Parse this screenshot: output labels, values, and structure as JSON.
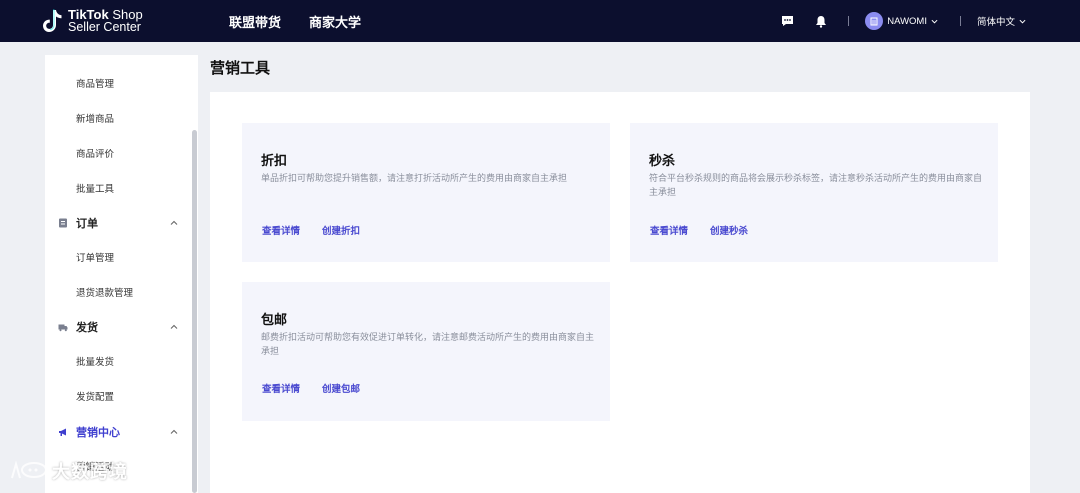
{
  "header": {
    "logo_line1_bold": "TikTok",
    "logo_line1_light": " Shop",
    "logo_line2": "Seller Center",
    "nav": [
      "联盟带货",
      "商家大学"
    ],
    "user_name": "NAWOMI",
    "language": "简体中文"
  },
  "sidebar": {
    "items": [
      {
        "type": "sub",
        "label": "商品管理"
      },
      {
        "type": "sub",
        "label": "新增商品"
      },
      {
        "type": "sub",
        "label": "商品评价"
      },
      {
        "type": "sub",
        "label": "批量工具"
      },
      {
        "type": "group",
        "label": "订单",
        "icon": "clipboard-icon"
      },
      {
        "type": "sub",
        "label": "订单管理"
      },
      {
        "type": "sub",
        "label": "退货退款管理"
      },
      {
        "type": "group",
        "label": "发货",
        "icon": "truck-icon"
      },
      {
        "type": "sub",
        "label": "批量发货"
      },
      {
        "type": "sub",
        "label": "发货配置"
      },
      {
        "type": "group",
        "label": "营销中心",
        "icon": "megaphone-icon",
        "active": true
      },
      {
        "type": "sub",
        "label": "营销活动"
      }
    ]
  },
  "main": {
    "title": "营销工具",
    "cards": [
      {
        "title": "折扣",
        "desc": "单品折扣可帮助您提升销售额，请注意打折活动所产生的费用由商家自主承担",
        "links": [
          "查看详情",
          "创建折扣"
        ]
      },
      {
        "title": "秒杀",
        "desc": "符合平台秒杀规则的商品将会展示秒杀标签，请注意秒杀活动所产生的费用由商家自主承担",
        "links": [
          "查看详情",
          "创建秒杀"
        ]
      },
      {
        "title": "包邮",
        "desc": "邮费折扣活动可帮助您有效促进订单转化，请注意邮费活动所产生的费用由商家自主承担",
        "links": [
          "查看详情",
          "创建包邮"
        ]
      }
    ]
  },
  "watermark": "大数跨境",
  "colors": {
    "header_bg": "#0c0f2e",
    "accent": "#4a4ad0",
    "card_bg": "#f4f5fc"
  }
}
